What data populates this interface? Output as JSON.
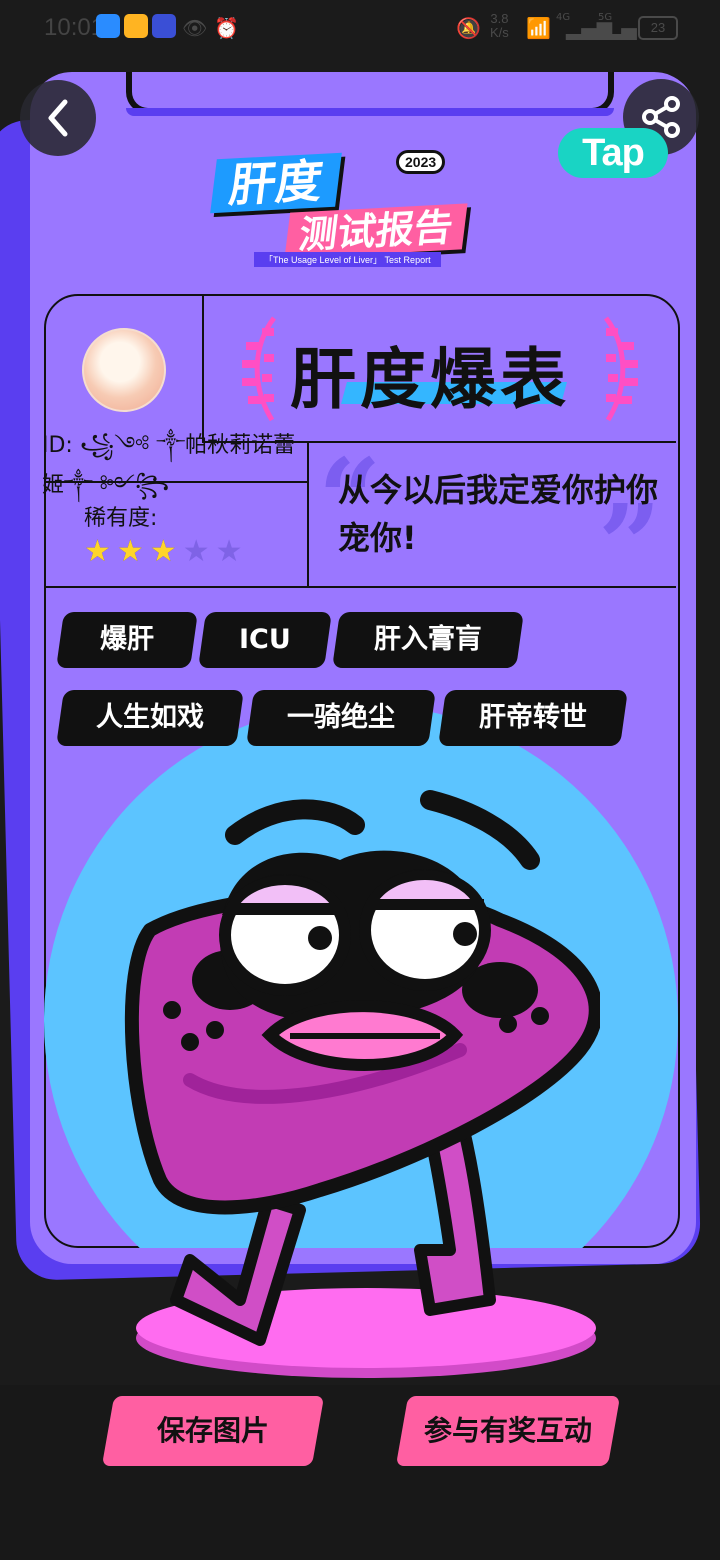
{
  "status_bar": {
    "time": "10:01",
    "network_speed": "3.8",
    "network_unit": "K/s",
    "signal_1": "4G",
    "signal_2": "5G",
    "battery": "23"
  },
  "header": {
    "title_top": "肝度",
    "title_year": "2023",
    "title_bottom": "测试报告",
    "title_sub": "「The Usage Level of Liver」 Test Report",
    "logo": "Tap"
  },
  "profile": {
    "id_text": "ID: ꧁༺ ༒帕秋莉诺蕾姬༒ ༻꧂",
    "rarity_label": "稀有度:",
    "rarity": 3,
    "rarity_max": 5
  },
  "result": {
    "badge": "肝度爆表",
    "quote": "从今以后我定爱你护你宠你!"
  },
  "tags": [
    "爆肝",
    "ICU",
    "肝入膏肓",
    "人生如戏",
    "一骑绝尘",
    "肝帝转世"
  ],
  "actions": {
    "save": "保存图片",
    "interact": "参与有奖互动"
  },
  "colors": {
    "card": "#9a77ff",
    "card_shadow": "#5a3ef0",
    "accent_pink": "#ff5fa2",
    "sky": "#5cc4ff",
    "liver": "#c23cb4"
  },
  "icons": {
    "back": "chevron-left-icon",
    "share": "share-icon"
  }
}
